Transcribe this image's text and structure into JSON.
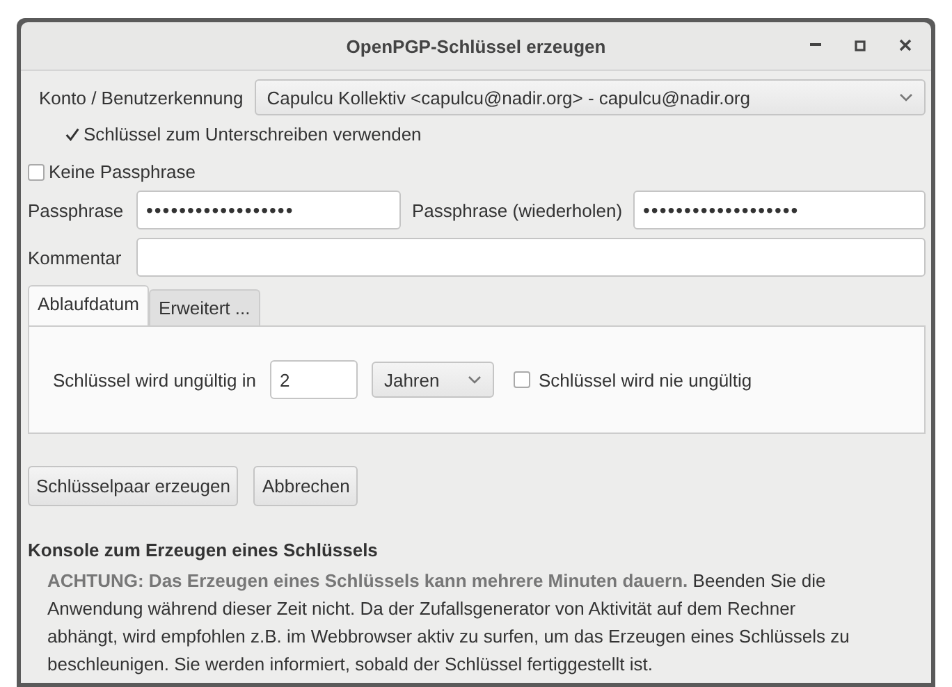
{
  "window": {
    "title": "OpenPGP-Schlüssel erzeugen"
  },
  "account": {
    "label": "Konto / Benutzerkennung",
    "value": "Capulcu Kollektiv <capulcu@nadir.org> - capulcu@nadir.org"
  },
  "use_for_signing": {
    "label": "Schlüssel zum Unterschreiben verwenden",
    "checked": true
  },
  "no_passphrase": {
    "label": "Keine Passphrase",
    "checked": false
  },
  "passphrase": {
    "label": "Passphrase",
    "value": "••••••••••••••••••"
  },
  "passphrase_repeat": {
    "label": "Passphrase (wiederholen)",
    "value": "•••••••••••••••••••"
  },
  "comment": {
    "label": "Kommentar"
  },
  "tabs": [
    {
      "label": "Ablaufdatum",
      "selected": true
    },
    {
      "label": "Erweitert ...",
      "selected": false
    }
  ],
  "expiry": {
    "label": "Schlüssel wird ungültig in",
    "amount": "2",
    "unit": "Jahren",
    "never": {
      "label": "Schlüssel wird nie ungültig",
      "checked": false
    }
  },
  "buttons": [
    "Schlüsselpaar erzeugen",
    "Abbrechen"
  ],
  "console": {
    "title": "Konsole zum Erzeugen eines Schlüssels",
    "text": "**ACHTUNG: Das Erzeugen eines Schlüssels kann mehrere Minuten dauern.** Beenden Sie die Anwendung während dieser Zeit nicht. Da der Zufallsgenerator von Aktivität auf dem Rechner abhängt, wird empfohlen z.B. im Webbrowser aktiv zu surfen, um das Erzeugen eines Schlüssels zu beschleunigen. Sie werden informiert, sobald der Schlüssel fertiggestellt ist."
  }
}
